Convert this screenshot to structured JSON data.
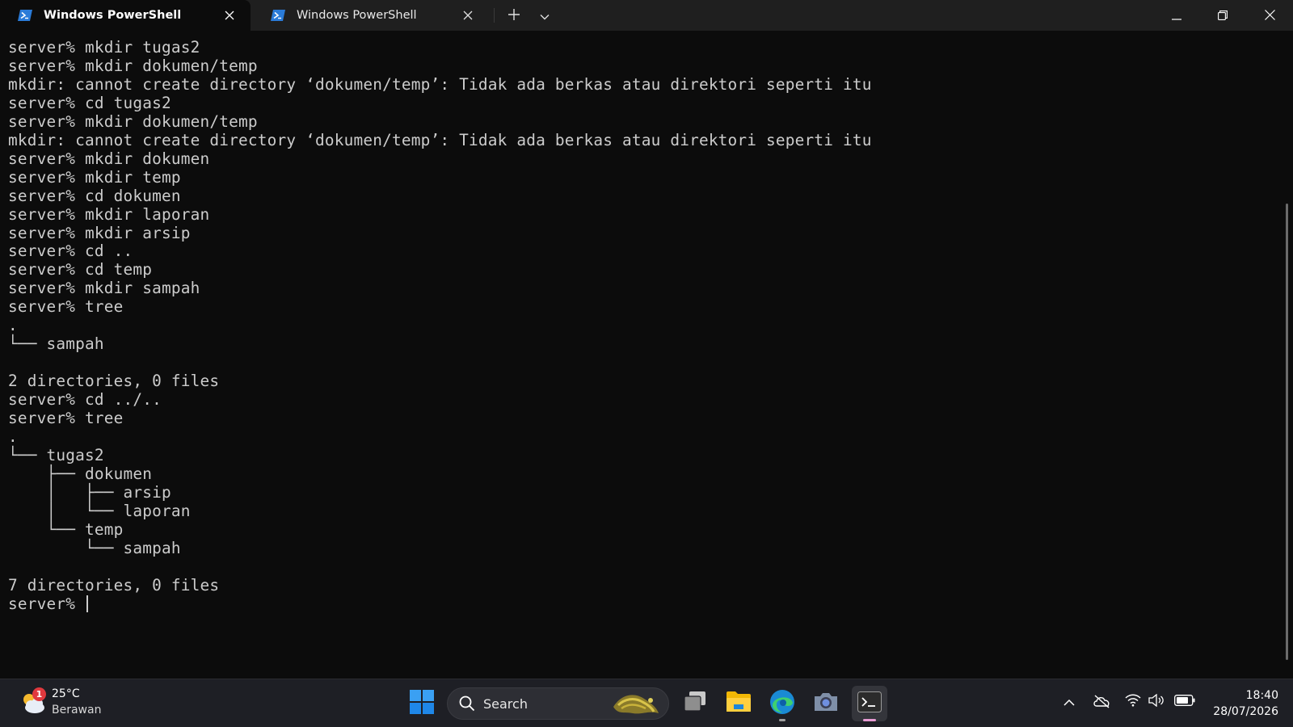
{
  "window": {
    "tabs": [
      {
        "label": "Windows PowerShell",
        "active": true
      },
      {
        "label": "Windows PowerShell",
        "active": false
      }
    ],
    "new_tab_icon": "plus-icon",
    "dropdown_icon": "chevron-down-icon",
    "controls": [
      "minimize-icon",
      "restore-icon",
      "close-icon"
    ]
  },
  "terminal": {
    "lines": [
      "server% mkdir tugas2",
      "server% mkdir dokumen/temp",
      "mkdir: cannot create directory ‘dokumen/temp’: Tidak ada berkas atau direktori seperti itu",
      "server% cd tugas2",
      "server% mkdir dokumen/temp",
      "mkdir: cannot create directory ‘dokumen/temp’: Tidak ada berkas atau direktori seperti itu",
      "server% mkdir dokumen",
      "server% mkdir temp",
      "server% cd dokumen",
      "server% mkdir laporan",
      "server% mkdir arsip",
      "server% cd ..",
      "server% cd temp",
      "server% mkdir sampah",
      "server% tree",
      ".",
      "└── sampah",
      "",
      "2 directories, 0 files",
      "server% cd ../..",
      "server% tree",
      ".",
      "└── tugas2",
      "    ├── dokumen",
      "    │   ├── arsip",
      "    │   └── laporan",
      "    └── temp",
      "        └── sampah",
      "",
      "7 directories, 0 files"
    ],
    "prompt": "server% "
  },
  "taskbar": {
    "weather": {
      "temp": "25°C",
      "condition": "Berawan",
      "badge": "1",
      "icon": "partly-cloudy-icon"
    },
    "search_label": "Search",
    "apps": [
      "start-icon",
      "search-icon",
      "task-view-icon",
      "file-explorer-icon",
      "edge-icon",
      "camera-icon",
      "terminal-icon"
    ],
    "tray_icons": [
      "chevron-up-icon",
      "onedrive-offline-icon",
      "wifi-icon",
      "volume-icon",
      "battery-icon"
    ],
    "time": "18:40",
    "date": "28/07/2026"
  },
  "colors": {
    "terminal_bg": "#0c0c0c",
    "terminal_fg": "#cccccc",
    "titlebar_bg": "#1f1f1f",
    "taskbar_bg": "#1e1f25",
    "accent": "#0078d4"
  }
}
